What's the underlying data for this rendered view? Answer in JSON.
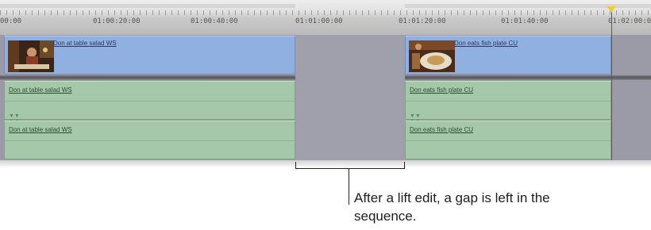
{
  "ruler": {
    "timecodes": [
      "00:00",
      "01:00:20:00",
      "01:00:40:00",
      "01:01:00:00",
      "01:01:20:00",
      "01:01:40:00",
      "01:02:00:00"
    ]
  },
  "clips": {
    "v1_left": "Don at table salad WS",
    "v1_right": "Don eats fish plate CU",
    "a1_left": "Don at table salad WS",
    "a1_right": "Don eats fish plate CU",
    "a2_left": "Don at table salad WS",
    "a2_right": "Don eats fish plate CU"
  },
  "callout": {
    "text": "After a lift edit, a gap is left in the sequence."
  },
  "colors": {
    "video_clip": "#8fb0e0",
    "audio_clip": "#a5c8aa",
    "gap": "#9fa0ab",
    "playhead": "#e9d03a"
  }
}
